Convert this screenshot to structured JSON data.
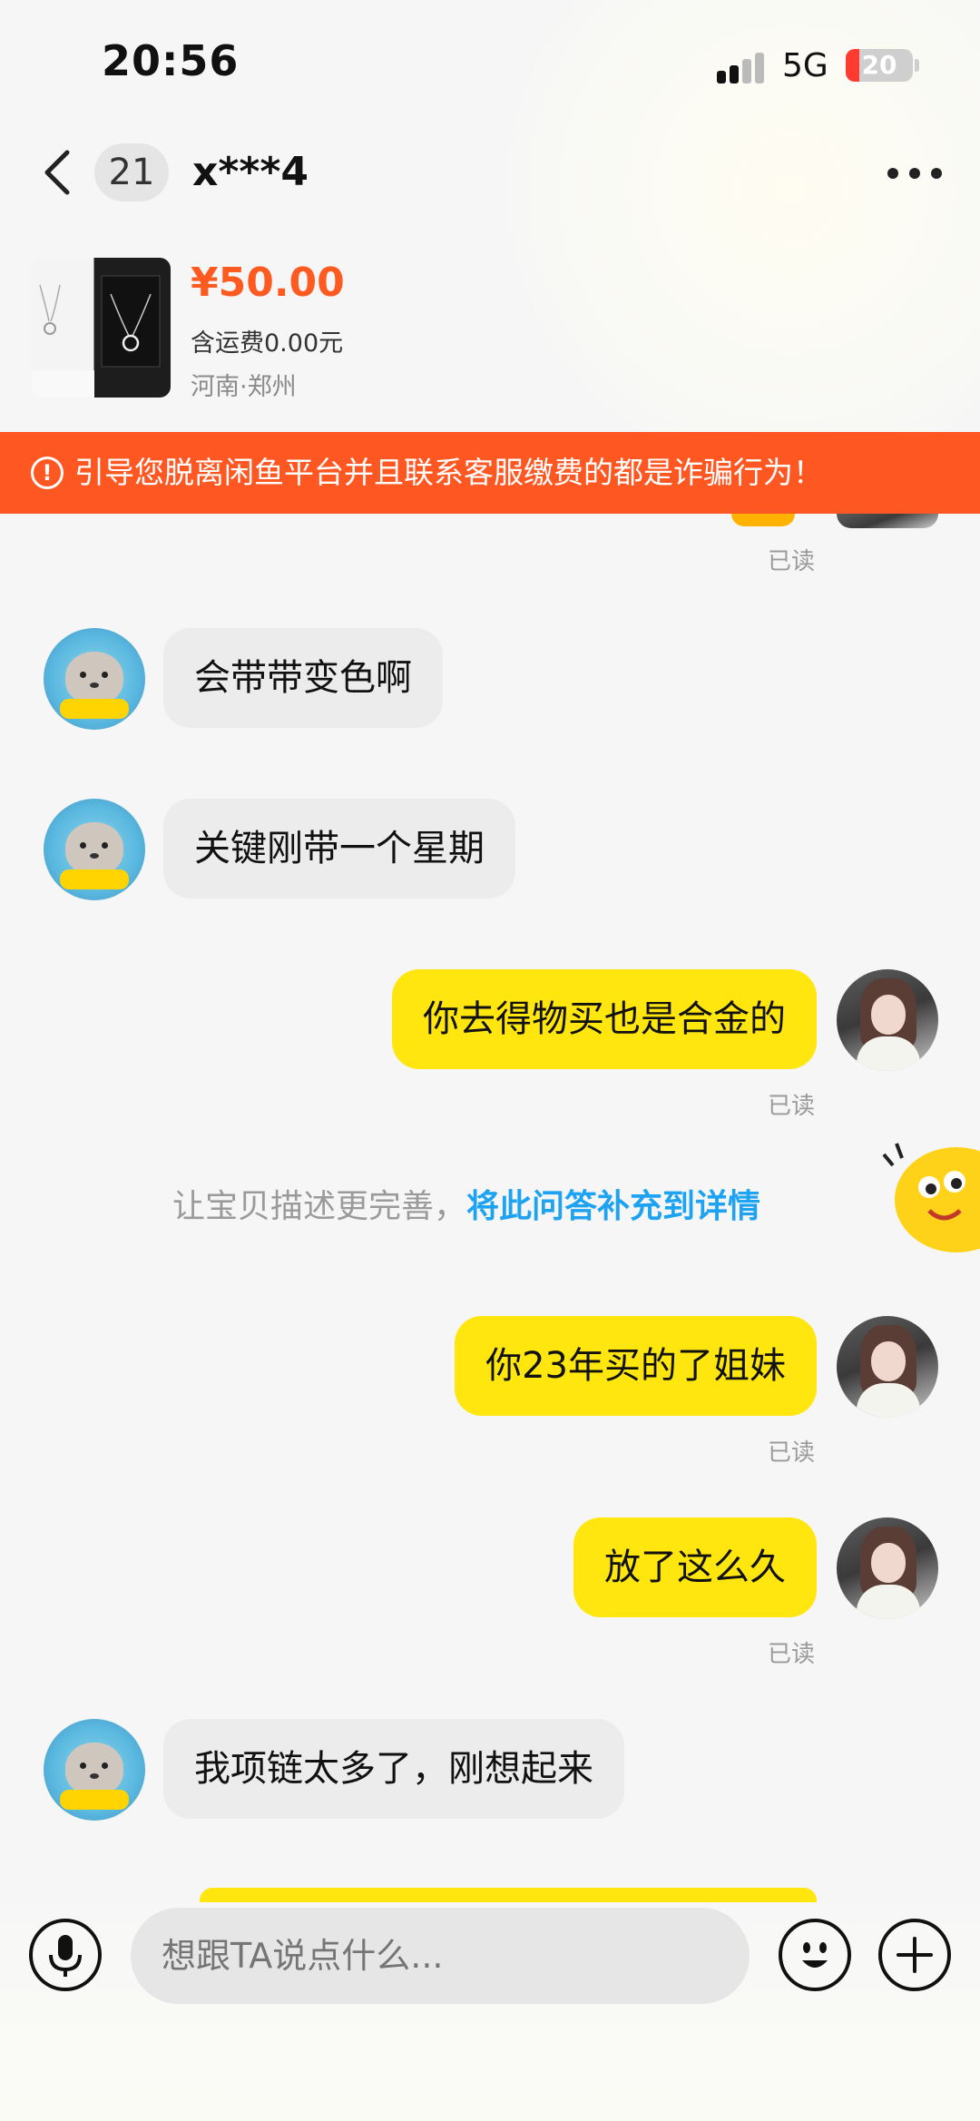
{
  "status_bar": {
    "time": "20:56",
    "network": "5G",
    "battery": "20",
    "battery_level": 0.2
  },
  "nav": {
    "unread_count": "21",
    "title": "x***4"
  },
  "product": {
    "price": "¥50.00",
    "shipping": "含运费0.00元",
    "location": "河南·郑州"
  },
  "warning": {
    "text": "引导您脱离闲鱼平台并且联系客服缴费的都是诈骗行为！",
    "icon": "exclamation-circle-icon"
  },
  "messages": [
    {
      "side": "out",
      "text": "",
      "status": "已读"
    },
    {
      "side": "in",
      "text": "会带带变色啊"
    },
    {
      "side": "in",
      "text": "关键刚带一个星期"
    },
    {
      "side": "out",
      "text": "你去得物买也是合金的",
      "status": "已读"
    },
    {
      "side": "out",
      "text": "你23年买的了姐妹",
      "status": "已读"
    },
    {
      "side": "out",
      "text": "放了这么久",
      "status": "已读"
    },
    {
      "side": "in",
      "text": "我项链太多了，刚想起来"
    }
  ],
  "hint": {
    "text": "让宝贝描述更完善，",
    "link": "将此问答补充到详情"
  },
  "input": {
    "placeholder": "想跟TA说点什么..."
  },
  "colors": {
    "accent_orange": "#ff5722",
    "price": "#ff5a1f",
    "outgoing_bubble": "#ffe60f",
    "incoming_bubble": "#ececec",
    "link": "#1ea3f2"
  }
}
